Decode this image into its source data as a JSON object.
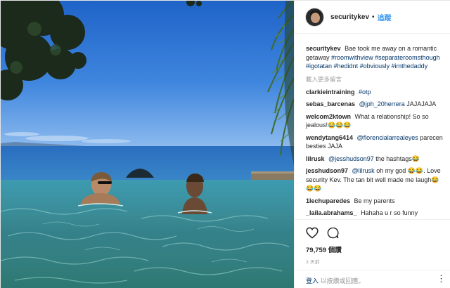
{
  "post": {
    "username": "securitykev",
    "follow_label": "追蹤",
    "dot": "•",
    "caption_user": "securitykev",
    "caption_text": "Bae took me away on a romantic getaway",
    "caption_tags": "#roomwithview #separateroomsthough #igotatan #hedidnt #obviously #imthedaddy",
    "load_more": "載入更多留言"
  },
  "comments": [
    {
      "user": "clarkieintraining",
      "mention": "",
      "text": "",
      "tag": "#otp"
    },
    {
      "user": "sebas_barcenas",
      "mention": "@jph_20herrera",
      "text": "JAJAJAJA",
      "tag": ""
    },
    {
      "user": "welcom2ktown",
      "mention": "",
      "text": "What a relationship! So so jealous!😂😂😂",
      "tag": ""
    },
    {
      "user": "wendytang6414",
      "mention": "@florencialarrealeyes",
      "text": "parecen besties JAJA",
      "tag": ""
    },
    {
      "user": "lilrusk",
      "mention": "@jesshudson97",
      "text": "the hashtags😂",
      "tag": ""
    },
    {
      "user": "jesshudson97",
      "mention": "@lilrusk",
      "text": "oh my god 😂😂. Love security Kev. The tan bit well made me laugh😂😂😂",
      "tag": ""
    },
    {
      "user": "1lechuparedes",
      "mention": "",
      "text": "Be my parents",
      "tag": ""
    },
    {
      "user": "_laila.abrahams_",
      "mention": "",
      "text": "Hahaha u r so funny",
      "tag": ""
    }
  ],
  "stats": {
    "likes_count": "79,759",
    "likes_suffix": "個讚",
    "time_ago": "3 天前"
  },
  "login_bar": {
    "login_link": "登入",
    "login_text": "以按讚或回應。",
    "more_icon": "⋮"
  },
  "icons": {
    "like": "heart-icon",
    "comment": "comment-icon"
  },
  "colors": {
    "link": "#003569",
    "follow": "#3897f0",
    "muted": "#999999"
  }
}
